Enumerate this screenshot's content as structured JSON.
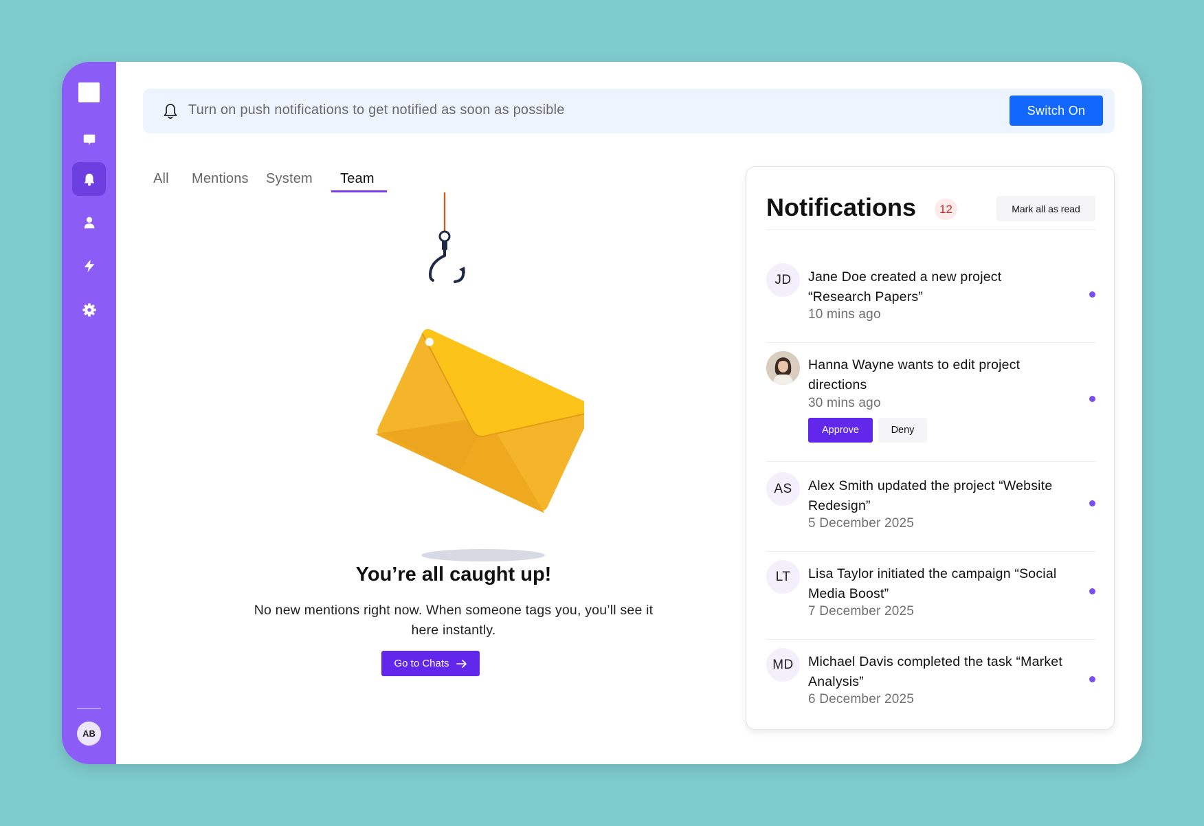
{
  "sidebar": {
    "items": [
      {
        "name": "chat",
        "icon": "chat-bubble-icon"
      },
      {
        "name": "notifications",
        "icon": "bell-icon",
        "active": true
      },
      {
        "name": "profile",
        "icon": "user-icon"
      },
      {
        "name": "activity",
        "icon": "lightning-icon"
      },
      {
        "name": "settings",
        "icon": "gear-icon"
      }
    ],
    "user_initials": "AB"
  },
  "banner": {
    "icon": "bell-outline-icon",
    "text": "Turn on push notifications to get notified as soon as possible",
    "button_label": "Switch On"
  },
  "tabs": [
    {
      "label": "All",
      "active": false
    },
    {
      "label": "Mentions",
      "active": false
    },
    {
      "label": "System",
      "active": false
    },
    {
      "label": "Team",
      "active": true
    }
  ],
  "empty_state": {
    "illustration": "envelope-on-hook-illustration",
    "title": "You’re all caught up!",
    "text": "No new mentions right now. When someone tags you, you’ll see it here instantly.",
    "button_label": "Go to Chats",
    "button_icon": "arrow-right-icon"
  },
  "panel": {
    "title": "Notifications",
    "count": "12",
    "mark_all_label": "Mark all as read",
    "items": [
      {
        "initials": "JD",
        "message": "Jane Doe created a new project “Research Papers”",
        "time": "10 mins ago",
        "unread": true
      },
      {
        "initials": "",
        "avatar": "photo-avatar",
        "message": "Hanna Wayne wants to edit project directions",
        "time": "30 mins ago",
        "unread": true,
        "actions": {
          "approve": "Approve",
          "deny": "Deny"
        }
      },
      {
        "initials": "AS",
        "message": "Alex Smith updated the project “Website Redesign”",
        "time": "5 December 2025",
        "unread": true
      },
      {
        "initials": "LT",
        "message": "Lisa Taylor initiated the campaign “Social Media Boost”",
        "time": "7 December 2025",
        "unread": true
      },
      {
        "initials": "MD",
        "message": "Michael Davis completed the task “Market Analysis”",
        "time": "6 December 2025",
        "unread": true
      }
    ]
  },
  "colors": {
    "background": "#7ecbcd",
    "sidebar": "#8b5cf6",
    "primary": "#6127ea",
    "blue_button": "#1267ff",
    "badge_red": "#d0261d",
    "unread_dot": "#7c4df0"
  }
}
